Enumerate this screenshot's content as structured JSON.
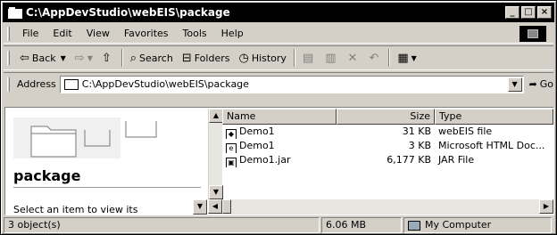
{
  "window": {
    "title": "C:\\AppDevStudio\\webEIS\\package",
    "minimize": "_",
    "maximize": "□",
    "close": "×"
  },
  "menu": [
    "File",
    "Edit",
    "View",
    "Favorites",
    "Tools",
    "Help"
  ],
  "toolbar": {
    "back": "Back",
    "search": "Search",
    "folders": "Folders",
    "history": "History"
  },
  "address": {
    "label": "Address",
    "value": "C:\\AppDevStudio\\webEIS\\package",
    "go": "Go"
  },
  "left_pane": {
    "folder_name": "package",
    "hint": "Select an item to view its"
  },
  "list": {
    "columns": [
      "Name",
      "Size",
      "Type"
    ],
    "rows": [
      {
        "name": "Demo1",
        "size": "31 KB",
        "type": "webEIS file",
        "icon": "webeis-file-icon"
      },
      {
        "name": "Demo1",
        "size": "3 KB",
        "type": "Microsoft HTML Doc...",
        "icon": "html-document-icon"
      },
      {
        "name": "Demo1.jar",
        "size": "6,177 KB",
        "type": "JAR File",
        "icon": "jar-file-icon"
      }
    ]
  },
  "status": {
    "objects": "3 object(s)",
    "size": "6.06 MB",
    "zone": "My Computer"
  }
}
